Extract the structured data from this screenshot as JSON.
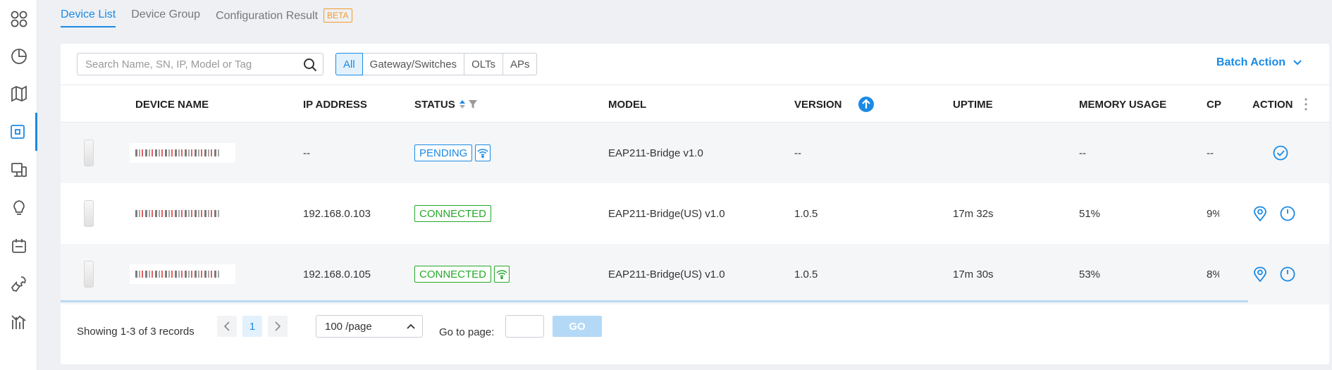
{
  "tabs": [
    {
      "label": "Device List",
      "active": true
    },
    {
      "label": "Device Group"
    },
    {
      "label": "Configuration Result",
      "badge": "BETA"
    }
  ],
  "toolbar": {
    "search_placeholder": "Search Name, SN, IP, Model or Tag",
    "filters": [
      "All",
      "Gateway/Switches",
      "OLTs",
      "APs"
    ],
    "active_filter": "All",
    "batch_action_label": "Batch Action"
  },
  "table": {
    "columns": [
      "DEVICE NAME",
      "IP ADDRESS",
      "STATUS",
      "MODEL",
      "VERSION",
      "UPTIME",
      "MEMORY USAGE",
      "CP",
      "ACTION"
    ],
    "rows": [
      {
        "ip": "--",
        "status": "PENDING",
        "model": "EAP211-Bridge v1.0",
        "version": "--",
        "uptime": "",
        "memory": "--",
        "cpu": "--"
      },
      {
        "ip": "192.168.0.103",
        "status": "CONNECTED",
        "model": "EAP211-Bridge(US) v1.0",
        "version": "1.0.5",
        "uptime": "17m 32s",
        "memory": "51%",
        "cpu": "9%"
      },
      {
        "ip": "192.168.0.105",
        "status": "CONNECTED",
        "model": "EAP211-Bridge(US) v1.0",
        "version": "1.0.5",
        "uptime": "17m 30s",
        "memory": "53%",
        "cpu": "8%"
      }
    ]
  },
  "footer": {
    "records": "Showing 1-3 of 3 records",
    "current_page": "1",
    "page_size": "100 /page",
    "goto_label": "Go to page:",
    "go_label": "GO"
  },
  "colors": {
    "accent": "#1a8ae5",
    "connected": "#27a82a",
    "beta": "#f59a2c"
  },
  "icons": {
    "sidebar": [
      "dashboard-grid-icon",
      "statistics-pie-icon",
      "map-icon",
      "devices-icon",
      "clients-icon",
      "insight-bulb-icon",
      "logs-icon",
      "tools-wrench-icon",
      "reports-chart-icon"
    ]
  }
}
